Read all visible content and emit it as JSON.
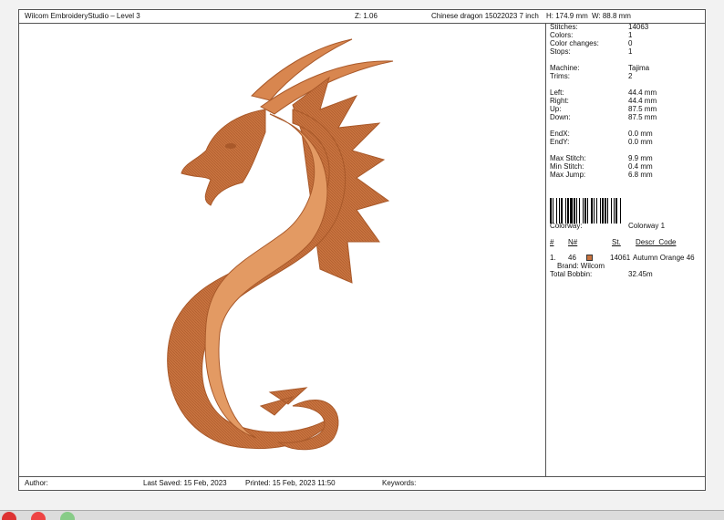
{
  "header": {
    "app_title": "Wilcom EmbroideryStudio – Level 3",
    "zoom": "Z: 1.06",
    "design_name": "Chinese dragon 15022023 7 inch",
    "height": "H: 174.9 mm",
    "width": "W: 88.8 mm"
  },
  "stats": [
    {
      "label": "Stitches:",
      "value": "14063"
    },
    {
      "label": "Colors:",
      "value": "1"
    },
    {
      "label": "Color changes:",
      "value": "0"
    },
    {
      "label": "Stops:",
      "value": "1"
    },
    {
      "label": "Machine:",
      "value": "Tajima"
    },
    {
      "label": "Trims:",
      "value": "2"
    },
    {
      "label": "Left:",
      "value": "44.4 mm"
    },
    {
      "label": "Right:",
      "value": "44.4 mm"
    },
    {
      "label": "Up:",
      "value": "87.5 mm"
    },
    {
      "label": "Down:",
      "value": "87.5 mm"
    },
    {
      "label": "EndX:",
      "value": "0.0 mm"
    },
    {
      "label": "EndY:",
      "value": "0.0 mm"
    },
    {
      "label": "Max Stitch:",
      "value": "9.9 mm"
    },
    {
      "label": "Min Stitch:",
      "value": "0.4 mm"
    },
    {
      "label": "Max Jump:",
      "value": "6.8 mm"
    }
  ],
  "colorway": {
    "label": "Colorway:",
    "value": "Colorway 1"
  },
  "color_table": {
    "headers": [
      "#",
      "N#",
      "St.",
      "Descr_Code"
    ],
    "rows": [
      {
        "index": "1.",
        "number": "46",
        "stitches": "14061",
        "descr": "Autumn Orange 46",
        "brand": "Brand: Wilcom",
        "swatch": "#c8733f"
      }
    ]
  },
  "bobbin": {
    "label": "Total Bobbin:",
    "value": "32.45m"
  },
  "footer": {
    "author": "Author:",
    "last_saved": "Last Saved: 15 Feb, 2023",
    "printed": "Printed: 15 Feb, 2023 11:50",
    "keywords": "Keywords:"
  },
  "colors": {
    "thread": "#c8733f",
    "thread_dark": "#a9592a",
    "thread_light": "#e39a63"
  },
  "icons": [
    "dragon-embroidery-preview",
    "barcode-icon",
    "taskbar-app-icons"
  ]
}
